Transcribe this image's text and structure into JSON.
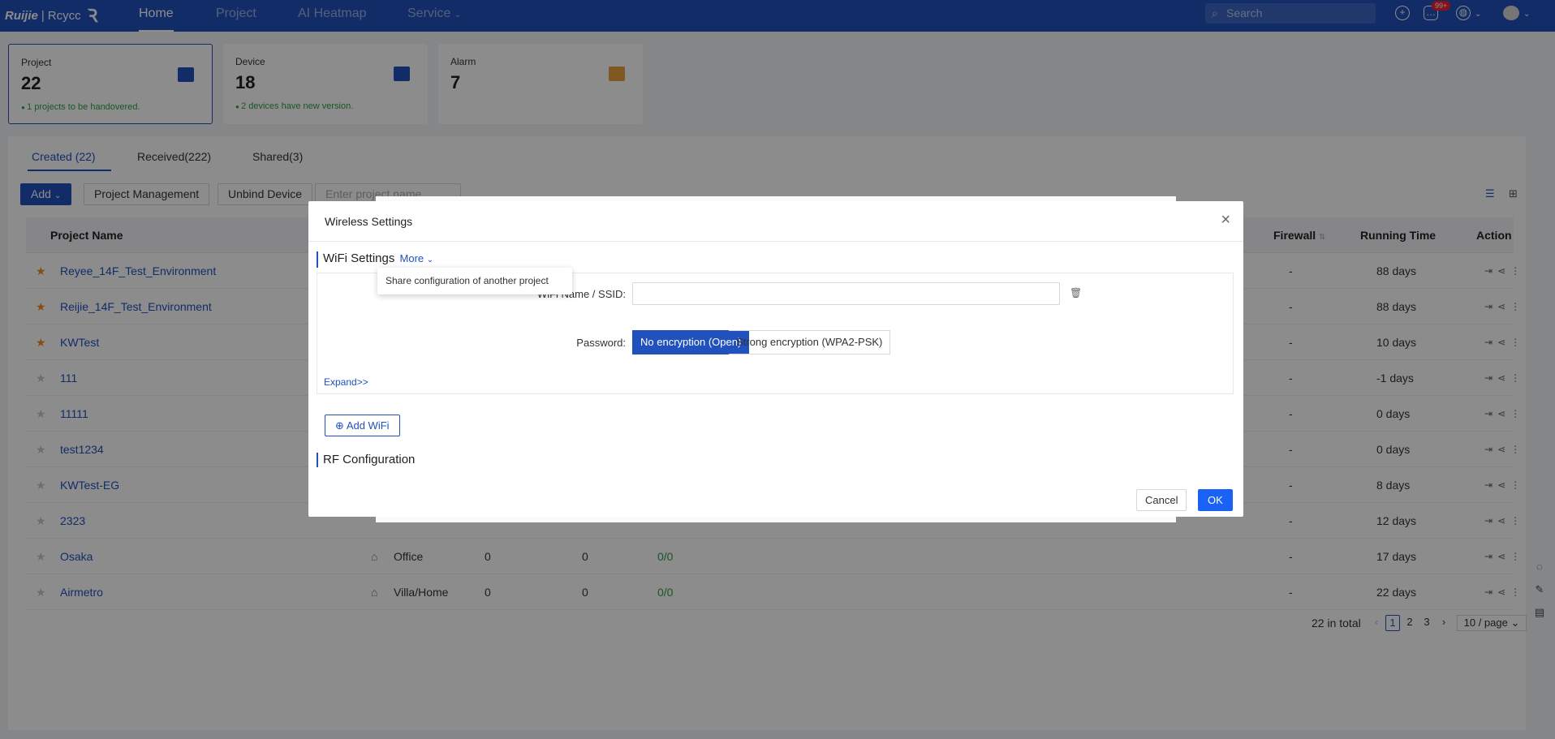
{
  "nav": {
    "brand": "Ruijie",
    "brand_sub": "Rcycc",
    "items": [
      "Home",
      "Project",
      "AI Heatmap",
      "Service"
    ],
    "search_placeholder": "Search",
    "notif_badge": "99+",
    "accent": "#2151bd"
  },
  "cards": [
    {
      "label": "Project",
      "value": "22",
      "tip": "1 projects to be handovered."
    },
    {
      "label": "Device",
      "value": "18",
      "tip": "2 devices have new version."
    },
    {
      "label": "Alarm",
      "value": "7",
      "tip": ""
    }
  ],
  "tabs": [
    "Created (22)",
    "Received(222)",
    "Shared(3)"
  ],
  "toolbar": {
    "add": "Add",
    "project_management": "Project Management",
    "unbind_device": "Unbind Device",
    "search_placeholder": "Enter project name"
  },
  "table": {
    "headers": [
      "Project Name",
      "Firewall",
      "Running Time",
      "Action"
    ],
    "rows": [
      {
        "name": "Reyee_14F_Test_Environment",
        "starred": true,
        "type": "",
        "c1": "",
        "c2": "",
        "c3": "",
        "firewall": "-",
        "time": "88 days"
      },
      {
        "name": "Reijie_14F_Test_Environment",
        "starred": true,
        "type": "",
        "c1": "",
        "c2": "",
        "c3": "",
        "firewall": "-",
        "time": "88 days"
      },
      {
        "name": "KWTest",
        "starred": true,
        "type": "",
        "c1": "",
        "c2": "",
        "c3": "",
        "firewall": "-",
        "time": "10 days"
      },
      {
        "name": "111",
        "starred": false,
        "type": "",
        "c1": "",
        "c2": "",
        "c3": "",
        "firewall": "-",
        "time": "-1 days"
      },
      {
        "name": "11111",
        "starred": false,
        "type": "",
        "c1": "",
        "c2": "",
        "c3": "",
        "firewall": "-",
        "time": "0 days"
      },
      {
        "name": "test1234",
        "starred": false,
        "type": "",
        "c1": "",
        "c2": "",
        "c3": "",
        "firewall": "-",
        "time": "0 days"
      },
      {
        "name": "KWTest-EG",
        "starred": false,
        "type": "",
        "c1": "",
        "c2": "",
        "c3": "",
        "firewall": "-",
        "time": "8 days"
      },
      {
        "name": "2323",
        "starred": false,
        "type": "",
        "c1": "",
        "c2": "",
        "c3": "",
        "firewall": "-",
        "time": "12 days"
      },
      {
        "name": "Osaka",
        "starred": false,
        "type": "Office",
        "c1": "0",
        "c2": "0",
        "c3": "0/0",
        "firewall": "-",
        "time": "17 days"
      },
      {
        "name": "Airmetro",
        "starred": false,
        "type": "Villa/Home",
        "c1": "0",
        "c2": "0",
        "c3": "0/0",
        "firewall": "-",
        "time": "22 days"
      }
    ]
  },
  "pager": {
    "total": "22 in total",
    "pages": [
      "1",
      "2",
      "3"
    ],
    "size": "10 / page"
  },
  "modal": {
    "title": "Wireless Settings",
    "wifi_section": "WiFi Settings",
    "more": "More",
    "tooltip": "Share configuration of another project",
    "ssid_label": "WiFi Name / SSID:",
    "ssid_value": "",
    "password_label": "Password:",
    "pw_open": "No encryption (Open)",
    "pw_strong": "Strong encryption (WPA2-PSK)",
    "expand": "Expand>>",
    "add_wifi": "Add WiFi",
    "rf_section": "RF Configuration",
    "cancel": "Cancel",
    "ok": "OK"
  }
}
